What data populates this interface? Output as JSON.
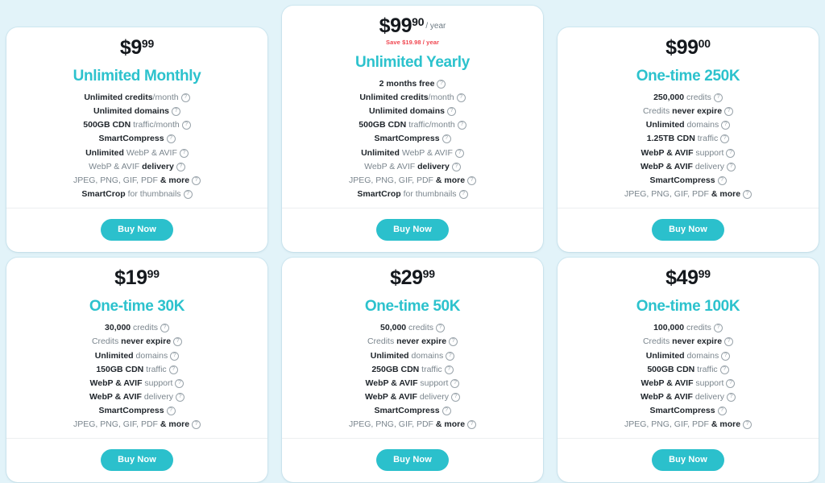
{
  "theme": {
    "page_background": "#e2f3f9",
    "card_background": "#ffffff",
    "accent": "#2cc2cd",
    "button": "#2bc0cc",
    "price_color": "#14181d",
    "save_color": "#f0454f",
    "muted_text": "#7b868e",
    "strong_text": "#20262c"
  },
  "common": {
    "buy_label": "Buy Now",
    "help_icon": "question-circle-icon"
  },
  "plans": [
    {
      "id": "unlimited-monthly",
      "name": "Unlimited Monthly",
      "price_currency": "$",
      "price_whole": "9",
      "price_cents": "99",
      "price_period": "",
      "save_note": "",
      "features": [
        [
          {
            "t": "Unlimited credits",
            "b": true
          },
          {
            "t": "/month",
            "b": false
          }
        ],
        [
          {
            "t": "Unlimited domains",
            "b": true
          }
        ],
        [
          {
            "t": "500GB CDN",
            "b": true
          },
          {
            "t": " traffic/month",
            "b": false
          }
        ],
        [
          {
            "t": "SmartCompress",
            "b": true
          }
        ],
        [
          {
            "t": "Unlimited",
            "b": true
          },
          {
            "t": " WebP & AVIF",
            "b": false
          }
        ],
        [
          {
            "t": "WebP & AVIF ",
            "b": false
          },
          {
            "t": "delivery",
            "b": true
          }
        ],
        [
          {
            "t": "JPEG, PNG, GIF, PDF ",
            "b": false
          },
          {
            "t": "& more",
            "b": true
          }
        ],
        [
          {
            "t": "SmartCrop",
            "b": true
          },
          {
            "t": " for thumbnails",
            "b": false
          }
        ]
      ]
    },
    {
      "id": "unlimited-yearly",
      "name": "Unlimited Yearly",
      "price_currency": "$",
      "price_whole": "99",
      "price_cents": "90",
      "price_period": "/ year",
      "save_note": "Save $19.98 / year",
      "features": [
        [
          {
            "t": "2 months free",
            "b": true
          }
        ],
        [
          {
            "t": "Unlimited credits",
            "b": true
          },
          {
            "t": "/month",
            "b": false
          }
        ],
        [
          {
            "t": "Unlimited domains",
            "b": true
          }
        ],
        [
          {
            "t": "500GB CDN",
            "b": true
          },
          {
            "t": " traffic/month",
            "b": false
          }
        ],
        [
          {
            "t": "SmartCompress",
            "b": true
          }
        ],
        [
          {
            "t": "Unlimited",
            "b": true
          },
          {
            "t": " WebP & AVIF",
            "b": false
          }
        ],
        [
          {
            "t": "WebP & AVIF ",
            "b": false
          },
          {
            "t": "delivery",
            "b": true
          }
        ],
        [
          {
            "t": "JPEG, PNG, GIF, PDF ",
            "b": false
          },
          {
            "t": "& more",
            "b": true
          }
        ],
        [
          {
            "t": "SmartCrop",
            "b": true
          },
          {
            "t": " for thumbnails",
            "b": false
          }
        ]
      ]
    },
    {
      "id": "one-time-250k",
      "name": "One-time 250K",
      "price_currency": "$",
      "price_whole": "99",
      "price_cents": "00",
      "price_period": "",
      "save_note": "",
      "features": [
        [
          {
            "t": "250,000",
            "b": true
          },
          {
            "t": " credits",
            "b": false
          }
        ],
        [
          {
            "t": "Credits ",
            "b": false
          },
          {
            "t": "never expire",
            "b": true
          }
        ],
        [
          {
            "t": "Unlimited",
            "b": true
          },
          {
            "t": " domains",
            "b": false
          }
        ],
        [
          {
            "t": "1.25TB CDN",
            "b": true
          },
          {
            "t": " traffic",
            "b": false
          }
        ],
        [
          {
            "t": "WebP & AVIF",
            "b": true
          },
          {
            "t": " support",
            "b": false
          }
        ],
        [
          {
            "t": "WebP & AVIF",
            "b": true
          },
          {
            "t": " delivery",
            "b": false
          }
        ],
        [
          {
            "t": "SmartCompress",
            "b": true
          }
        ],
        [
          {
            "t": "JPEG, PNG, GIF, PDF ",
            "b": false
          },
          {
            "t": "& more",
            "b": true
          }
        ]
      ]
    },
    {
      "id": "one-time-30k",
      "name": "One-time 30K",
      "price_currency": "$",
      "price_whole": "19",
      "price_cents": "99",
      "price_period": "",
      "save_note": "",
      "features": [
        [
          {
            "t": "30,000",
            "b": true
          },
          {
            "t": " credits",
            "b": false
          }
        ],
        [
          {
            "t": "Credits ",
            "b": false
          },
          {
            "t": "never expire",
            "b": true
          }
        ],
        [
          {
            "t": "Unlimited",
            "b": true
          },
          {
            "t": " domains",
            "b": false
          }
        ],
        [
          {
            "t": "150GB CDN",
            "b": true
          },
          {
            "t": " traffic",
            "b": false
          }
        ],
        [
          {
            "t": "WebP & AVIF",
            "b": true
          },
          {
            "t": " support",
            "b": false
          }
        ],
        [
          {
            "t": "WebP & AVIF",
            "b": true
          },
          {
            "t": " delivery",
            "b": false
          }
        ],
        [
          {
            "t": "SmartCompress",
            "b": true
          }
        ],
        [
          {
            "t": "JPEG, PNG, GIF, PDF ",
            "b": false
          },
          {
            "t": "& more",
            "b": true
          }
        ]
      ]
    },
    {
      "id": "one-time-50k",
      "name": "One-time 50K",
      "price_currency": "$",
      "price_whole": "29",
      "price_cents": "99",
      "price_period": "",
      "save_note": "",
      "features": [
        [
          {
            "t": "50,000",
            "b": true
          },
          {
            "t": " credits",
            "b": false
          }
        ],
        [
          {
            "t": "Credits ",
            "b": false
          },
          {
            "t": "never expire",
            "b": true
          }
        ],
        [
          {
            "t": "Unlimited",
            "b": true
          },
          {
            "t": " domains",
            "b": false
          }
        ],
        [
          {
            "t": "250GB CDN",
            "b": true
          },
          {
            "t": " traffic",
            "b": false
          }
        ],
        [
          {
            "t": "WebP & AVIF",
            "b": true
          },
          {
            "t": " support",
            "b": false
          }
        ],
        [
          {
            "t": "WebP & AVIF",
            "b": true
          },
          {
            "t": " delivery",
            "b": false
          }
        ],
        [
          {
            "t": "SmartCompress",
            "b": true
          }
        ],
        [
          {
            "t": "JPEG, PNG, GIF, PDF ",
            "b": false
          },
          {
            "t": "& more",
            "b": true
          }
        ]
      ]
    },
    {
      "id": "one-time-100k",
      "name": "One-time 100K",
      "price_currency": "$",
      "price_whole": "49",
      "price_cents": "99",
      "price_period": "",
      "save_note": "",
      "features": [
        [
          {
            "t": "100,000",
            "b": true
          },
          {
            "t": " credits",
            "b": false
          }
        ],
        [
          {
            "t": "Credits ",
            "b": false
          },
          {
            "t": "never expire",
            "b": true
          }
        ],
        [
          {
            "t": "Unlimited",
            "b": true
          },
          {
            "t": " domains",
            "b": false
          }
        ],
        [
          {
            "t": "500GB CDN",
            "b": true
          },
          {
            "t": " traffic",
            "b": false
          }
        ],
        [
          {
            "t": "WebP & AVIF",
            "b": true
          },
          {
            "t": " support",
            "b": false
          }
        ],
        [
          {
            "t": "WebP & AVIF",
            "b": true
          },
          {
            "t": " delivery",
            "b": false
          }
        ],
        [
          {
            "t": "SmartCompress",
            "b": true
          }
        ],
        [
          {
            "t": "JPEG, PNG, GIF, PDF ",
            "b": false
          },
          {
            "t": "& more",
            "b": true
          }
        ]
      ]
    }
  ]
}
